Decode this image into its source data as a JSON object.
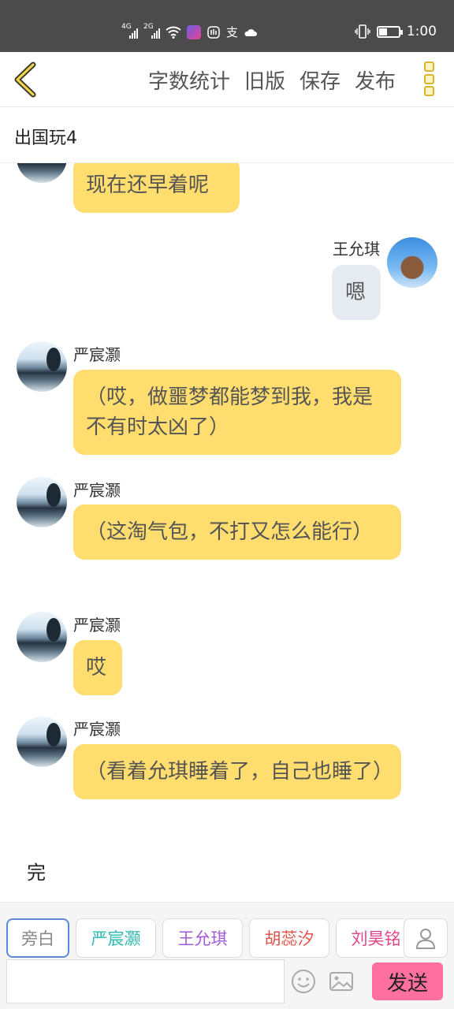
{
  "statusbar": {
    "net1": "4G",
    "net2": "2G",
    "time": "1:00"
  },
  "header": {
    "actions": [
      "字数统计",
      "旧版",
      "保存",
      "发布"
    ]
  },
  "title": "出国玩4",
  "messages": [
    {
      "text": "现在还早着呢"
    },
    {
      "name": "王允琪",
      "text": "嗯"
    },
    {
      "name": "严宸灏",
      "text": "（哎，做噩梦都能梦到我，我是不有时太凶了）"
    },
    {
      "name": "严宸灏",
      "text": "（这淘气包，不打又怎么能行）"
    },
    {
      "name": "严宸灏",
      "text": "哎"
    },
    {
      "name": "严宸灏",
      "text": "（看着允琪睡着了，自己也睡了）"
    }
  ],
  "ending": "完",
  "characters": [
    {
      "label": "旁白",
      "color": "#888888"
    },
    {
      "label": "严宸灏",
      "color": "#2bb9b0"
    },
    {
      "label": "王允琪",
      "color": "#a25bd6"
    },
    {
      "label": "胡蕊汐",
      "color": "#e0534a"
    },
    {
      "label": "刘昊铭",
      "color": "#e0468a"
    }
  ],
  "input": {
    "value": "",
    "placeholder": ""
  },
  "send_label": "发送",
  "colors": {
    "bubble_left": "#ffdd6e",
    "bubble_right": "#e6ebf2",
    "send": "#ff6fa0",
    "accent": "#d9b42f"
  },
  "icons": [
    "back-arrow-icon",
    "more-icon",
    "emoji-icon",
    "image-icon",
    "person-icon",
    "wifi-icon",
    "battery-icon"
  ]
}
